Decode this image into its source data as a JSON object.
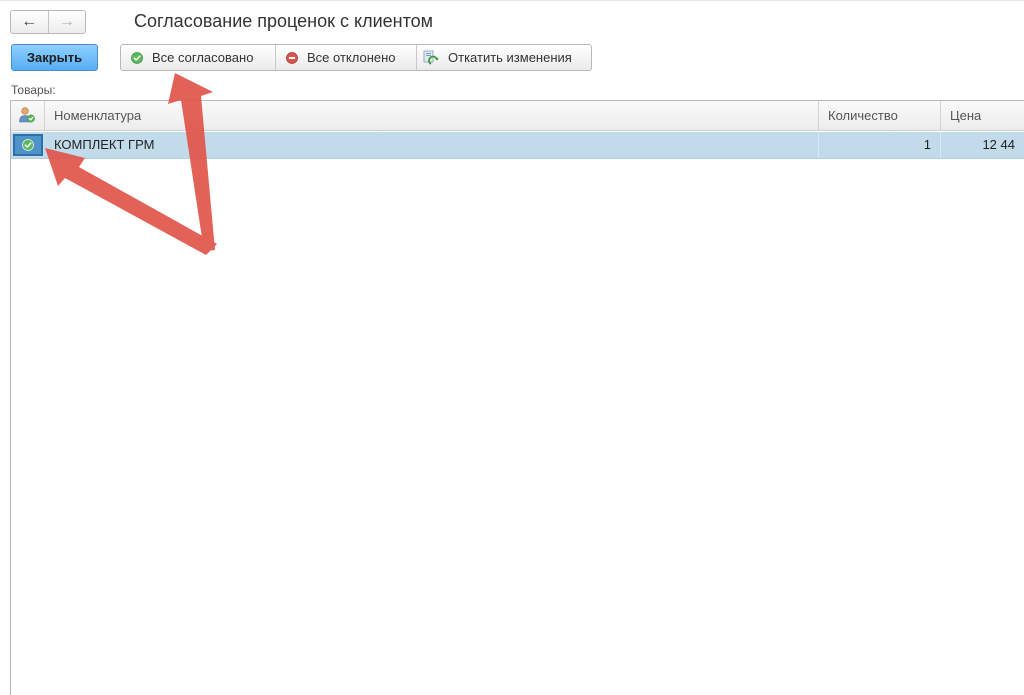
{
  "navigation": {
    "back_icon": "arrow-left-icon",
    "forward_icon": "arrow-right-icon",
    "back_glyph": "←",
    "forward_glyph": "→"
  },
  "form": {
    "title": "Согласование проценок с клиентом"
  },
  "toolbar": {
    "close_label": "Закрыть",
    "approve_all_label": "Все согласовано",
    "approve_all_icon": "green-check-icon",
    "reject_all_label": "Все отклонено",
    "reject_all_icon": "red-minus-icon",
    "rollback_label": "Откатить изменения",
    "rollback_icon": "rollback-icon"
  },
  "goods": {
    "label": "Товары:",
    "columns": {
      "status_icon": "person-check-icon",
      "nomenclature": "Номенклатура",
      "quantity": "Количество",
      "price": "Цена"
    },
    "rows": [
      {
        "status_icon": "green-check-icon",
        "nomenclature": "КОМПЛЕКТ ГРМ",
        "quantity": "1",
        "price": "12 44"
      }
    ]
  },
  "colors": {
    "close_button": "#57aef5",
    "selected_row": "#c2dbea",
    "annotation_arrow": "#e0554a",
    "approve_icon": "#5cb85c",
    "reject_icon": "#d9534f"
  }
}
